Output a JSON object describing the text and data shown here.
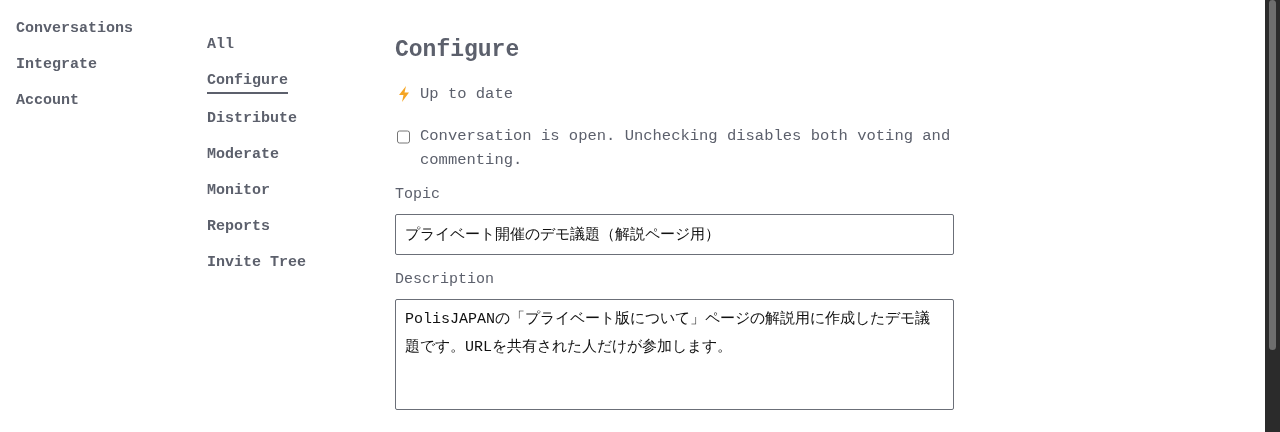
{
  "main_nav": {
    "items": [
      {
        "label": "Conversations",
        "selected": false
      },
      {
        "label": "Integrate",
        "selected": false
      },
      {
        "label": "Account",
        "selected": false
      }
    ]
  },
  "conversation_nav": {
    "items": [
      {
        "label": "All",
        "selected": false
      },
      {
        "label": "Configure",
        "selected": true
      },
      {
        "label": "Distribute",
        "selected": false
      },
      {
        "label": "Moderate",
        "selected": false
      },
      {
        "label": "Monitor",
        "selected": false
      },
      {
        "label": "Reports",
        "selected": false
      },
      {
        "label": "Invite Tree",
        "selected": false
      }
    ]
  },
  "page": {
    "title": "Configure",
    "status": "Up to date",
    "open_checkbox": {
      "label": "Conversation is open. Unchecking disables both voting and commenting.",
      "checked": false
    },
    "topic": {
      "label": "Topic",
      "value": "プライベート開催のデモ議題（解説ページ用）"
    },
    "description": {
      "label": "Description",
      "value": "PolisJAPANの「プライベート版について」ページの解説用に作成したデモ議題です。URLを共有された人だけが参加します。"
    }
  }
}
